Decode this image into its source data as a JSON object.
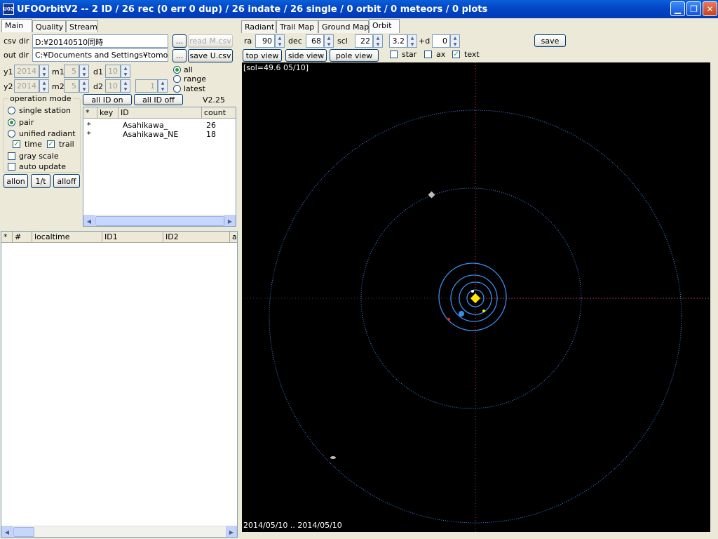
{
  "window": {
    "title": "UFOOrbitV2 -- 2 ID / 26 rec (0 err 0 dup) / 26 indate / 26 single / 0 orbit / 0 meteors / 0 plots",
    "icon_text": "U02"
  },
  "left_tabs": [
    "Main",
    "Quality",
    "Stream"
  ],
  "right_tabs": [
    "Radiant",
    "Trail Map",
    "Ground Map",
    "Orbit"
  ],
  "main": {
    "csv_dir_label": "csv dir",
    "csv_dir_value": "D:¥20140510同時",
    "out_dir_label": "out dir",
    "out_dir_value": "C:¥Documents and Settings¥tomohiko",
    "browse_label": "...",
    "read_mcsv_label": "read M.csv",
    "save_ucsv_label": "save U.csv",
    "y1_label": "y1",
    "y1_value": "2014",
    "m1_label": "m1",
    "m1_value": "5",
    "d1_label": "d1",
    "d1_value": "10",
    "y2_label": "y2",
    "y2_value": "2014",
    "m2_label": "m2",
    "m2_value": "5",
    "d2_label": "d2",
    "d2_value": "10",
    "latest_value": "1",
    "range_options": [
      "all",
      "range",
      "latest"
    ],
    "op_mode_label": "operation mode",
    "op_modes": [
      "single station",
      "pair",
      "unified radiant"
    ],
    "time_label": "time",
    "trail_label": "trail",
    "gray_scale_label": "gray scale",
    "auto_update_label": "auto update",
    "allon_label": "allon",
    "inv_label": "1/t",
    "alloff_label": "alloff",
    "all_id_on_label": "all ID on",
    "all_id_off_label": "all ID off",
    "version": "V2.25"
  },
  "id_list": {
    "headers": [
      "*",
      "key",
      "ID",
      "count"
    ],
    "rows": [
      {
        "star": "*",
        "key": "",
        "id": "Asahikawa_",
        "count": "26"
      },
      {
        "star": "*",
        "key": "",
        "id": "Asahikawa_NE",
        "count": "18"
      }
    ]
  },
  "meteor_list": {
    "headers": [
      "*",
      "#",
      "localtime",
      "ID1",
      "ID2",
      "a"
    ]
  },
  "orbit_controls": {
    "ra_label": "ra",
    "ra_value": "90",
    "dec_label": "dec",
    "dec_value": "68",
    "scl_label": "scl",
    "scl_value": "22",
    "d_value": "3.2",
    "d_label": "+d",
    "d2_value": "0",
    "save_label": "save",
    "top_view_label": "top view",
    "side_view_label": "side view",
    "pole_view_label": "pole view",
    "star_label": "star",
    "ax_label": "ax",
    "text_label": "text"
  },
  "orbit_view": {
    "sol_text": "[sol=49.6 05/10]",
    "date_range": "2014/05/10 .. 2014/05/10"
  },
  "colors": {
    "sun": "#FFE600",
    "orbit": "#3C8CF0",
    "axis_red": "#E03030",
    "bg": "#000000"
  }
}
